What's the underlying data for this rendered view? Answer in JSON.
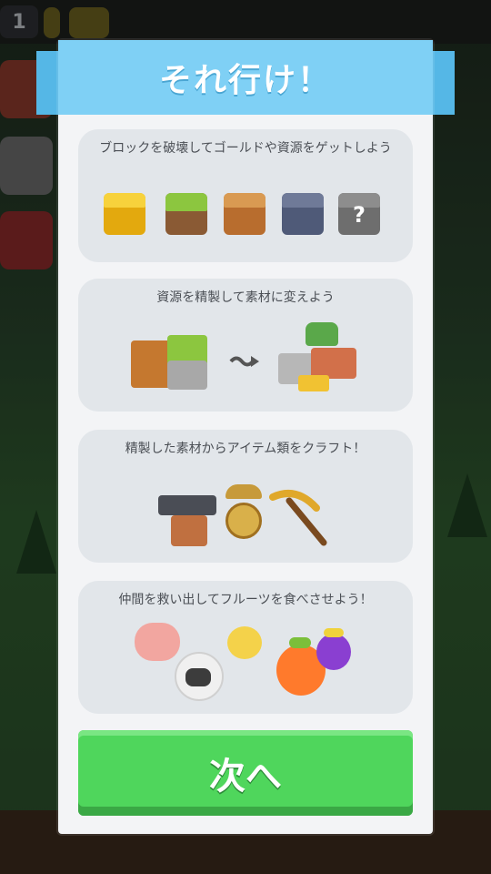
{
  "hud": {
    "level": "1"
  },
  "modal": {
    "title": "それ行け！",
    "cards": [
      {
        "caption": "ブロックを破壊してゴールドや資源をゲットしよう"
      },
      {
        "caption": "資源を精製して素材に変えよう"
      },
      {
        "caption": "精製した素材からアイテム類をクラフト！"
      },
      {
        "caption": "仲間を救い出してフルーツを食べさせよう！"
      }
    ],
    "mystery_block_symbol": "?",
    "next_button": "次へ"
  }
}
